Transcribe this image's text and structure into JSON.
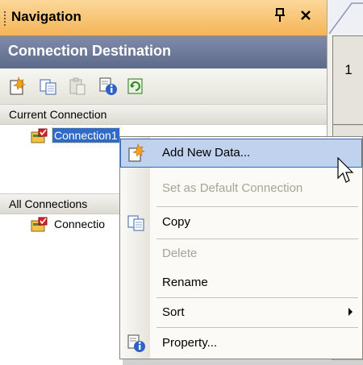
{
  "panel": {
    "title": "Navigation",
    "pin_glyph": "ѱ",
    "close_glyph": "×",
    "header": "Connection Destination"
  },
  "toolbar": {
    "buttons": [
      {
        "icon": "new-connection-icon",
        "enabled": true
      },
      {
        "icon": "copy-icon",
        "enabled": true
      },
      {
        "icon": "paste-icon",
        "enabled": false
      },
      {
        "icon": "property-icon",
        "enabled": true
      },
      {
        "icon": "refresh-icon",
        "enabled": true
      }
    ]
  },
  "current_section": {
    "label": "Current Connection",
    "items": [
      {
        "name": "Connection1",
        "selected": true
      }
    ]
  },
  "all_section": {
    "label": "All Connections",
    "items": [
      {
        "name": "Connectio",
        "selected": false
      }
    ]
  },
  "document": {
    "row_number": "1"
  },
  "context_menu": {
    "items": [
      {
        "label": "Add New Data...",
        "icon": "add-new-data-icon",
        "enabled": true,
        "highlighted": true
      },
      {
        "label": "Set as Default Connection",
        "enabled": false
      },
      {
        "label": "Copy",
        "icon": "copy-icon",
        "enabled": true
      },
      {
        "label": "Delete",
        "enabled": false
      },
      {
        "label": "Rename",
        "enabled": true
      },
      {
        "label": "Sort",
        "enabled": true,
        "has_submenu": true
      },
      {
        "label": "Property...",
        "icon": "property-icon",
        "enabled": true
      }
    ]
  },
  "colors": {
    "title_bar": "#f5b557",
    "header_bar": "#6b7798",
    "selection": "#3169c6",
    "menu_highlight": "#c1d2ee"
  }
}
